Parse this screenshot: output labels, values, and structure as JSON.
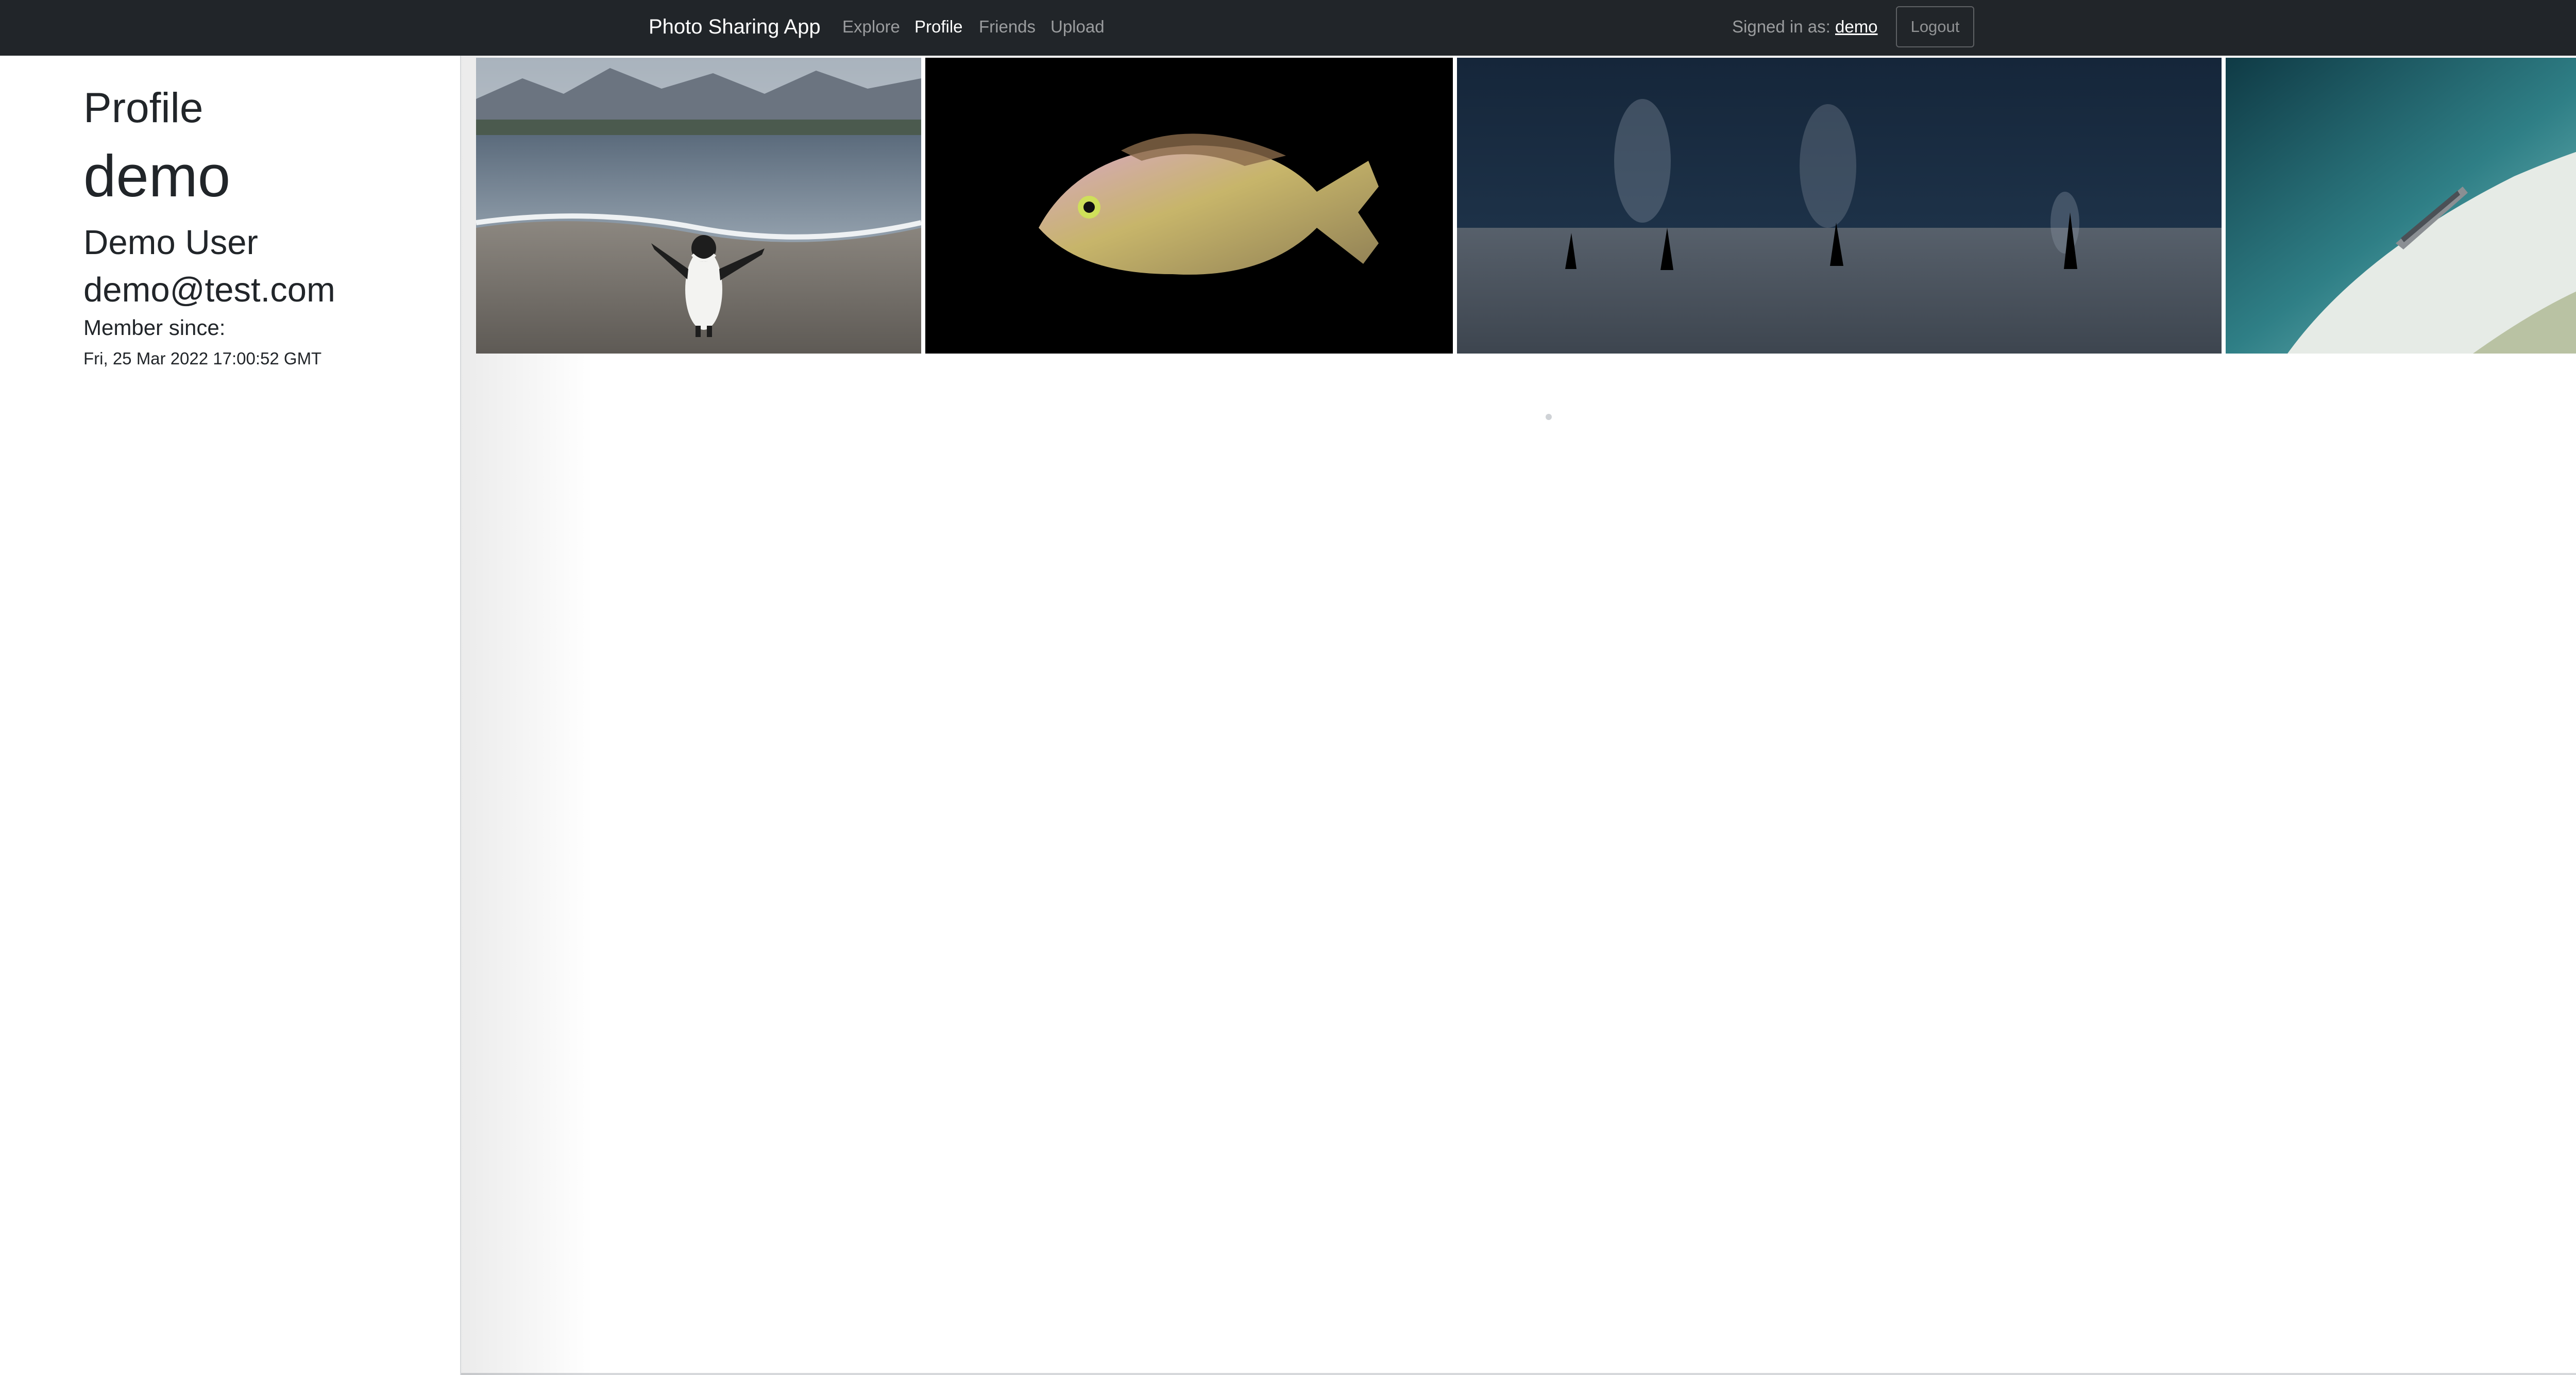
{
  "navbar": {
    "brand": "Photo Sharing App",
    "links": [
      {
        "label": "Explore",
        "active": false
      },
      {
        "label": "Profile",
        "active": true
      },
      {
        "label": "Friends",
        "active": false
      },
      {
        "label": "Upload",
        "active": false
      }
    ],
    "signed_in_prefix": "Signed in as:",
    "signed_in_user": "demo",
    "logout_label": "Logout"
  },
  "profile": {
    "heading": "Profile",
    "username": "demo",
    "full_name": "Demo User",
    "email": "demo@test.com",
    "member_since_label": "Member since:",
    "member_since_date": "Fri, 25 Mar 2022 17:00:52 GMT"
  },
  "photos": [
    {
      "subject": "penguin on pebble beach"
    },
    {
      "subject": "colorful fish on black background"
    },
    {
      "subject": "orcas in dark sea"
    },
    {
      "subject": "aerial view of boat on white sand beach"
    }
  ],
  "colors": {
    "navbar_bg": "#212529",
    "nav_text": "#ffffff",
    "nav_muted": "#8c8f92",
    "page_bg": "#ffffff",
    "text": "#212529"
  }
}
